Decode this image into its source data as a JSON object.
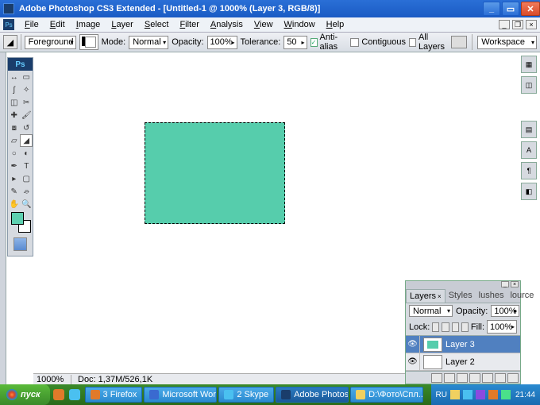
{
  "titlebar": {
    "title": "Adobe Photoshop CS3 Extended - [Untitled-1 @ 1000% (Layer 3, RGB/8)]"
  },
  "menu": {
    "items": [
      "File",
      "Edit",
      "Image",
      "Layer",
      "Select",
      "Filter",
      "Analysis",
      "View",
      "Window",
      "Help"
    ]
  },
  "options": {
    "fill_label": "Foreground",
    "mode_label": "Mode:",
    "mode_value": "Normal",
    "opacity_label": "Opacity:",
    "opacity_value": "100%",
    "tolerance_label": "Tolerance:",
    "tolerance_value": "50",
    "antialias_label": "Anti-alias",
    "antialias_checked": true,
    "contiguous_label": "Contiguous",
    "contiguous_checked": false,
    "alllayers_label": "All Layers",
    "alllayers_checked": false,
    "workspace_label": "Workspace"
  },
  "tools": [
    [
      "move",
      "marquee"
    ],
    [
      "lasso",
      "magic-wand"
    ],
    [
      "crop",
      "slice"
    ],
    [
      "healing",
      "brush"
    ],
    [
      "stamp",
      "history-brush"
    ],
    [
      "eraser",
      "paint-bucket"
    ],
    [
      "blur",
      "dodge"
    ],
    [
      "pen",
      "type"
    ],
    [
      "path-select",
      "shape"
    ],
    [
      "notes",
      "eyedropper"
    ],
    [
      "hand",
      "zoom"
    ]
  ],
  "tool_glyphs": {
    "move": "↔",
    "marquee": "▭",
    "lasso": "ʃ",
    "magic-wand": "✧",
    "crop": "◫",
    "slice": "✂",
    "healing": "✚",
    "brush": "🖌",
    "stamp": "⧇",
    "history-brush": "↺",
    "eraser": "▱",
    "paint-bucket": "◢",
    "blur": "○",
    "dodge": "◐",
    "pen": "✒",
    "type": "T",
    "path-select": "▸",
    "shape": "▢",
    "notes": "✎",
    "eyedropper": "⌮",
    "hand": "✋",
    "zoom": "🔍"
  },
  "selected_tool": "paint-bucket",
  "colors": {
    "fg": "#5dd0b0",
    "bg": "#ffffff",
    "rect": "#56cdac"
  },
  "status": {
    "zoom": "1000%",
    "doc": "Doc: 1,37M/526,1K"
  },
  "layers_panel": {
    "tabs": [
      "Layers",
      "Styles",
      "lushes",
      "lource"
    ],
    "active_tab": 0,
    "blend_mode": "Normal",
    "opacity_label": "Opacity:",
    "opacity_value": "100%",
    "lock_label": "Lock:",
    "fill_label": "Fill:",
    "fill_value": "100%",
    "layers": [
      {
        "name": "Layer 3",
        "visible": true,
        "selected": true
      },
      {
        "name": "Layer 2",
        "visible": true,
        "selected": false
      }
    ]
  },
  "dock_icons": [
    "nav",
    "color",
    "swatch",
    "styles",
    "char",
    "para"
  ],
  "taskbar": {
    "start": "пуск",
    "items": [
      {
        "label": "3 Firefox",
        "color": "#e07a2a"
      },
      {
        "label": "Microsoft Wor...",
        "color": "#3a6ad0"
      },
      {
        "label": "2 Skype",
        "color": "#4ac0f0"
      },
      {
        "label": "Adobe Photos...",
        "color": "#1a3d6b",
        "active": true
      },
      {
        "label": "D:\\Фото\\Спл...",
        "color": "#f0d060"
      }
    ],
    "lang": "RU",
    "clock": "21:44"
  }
}
